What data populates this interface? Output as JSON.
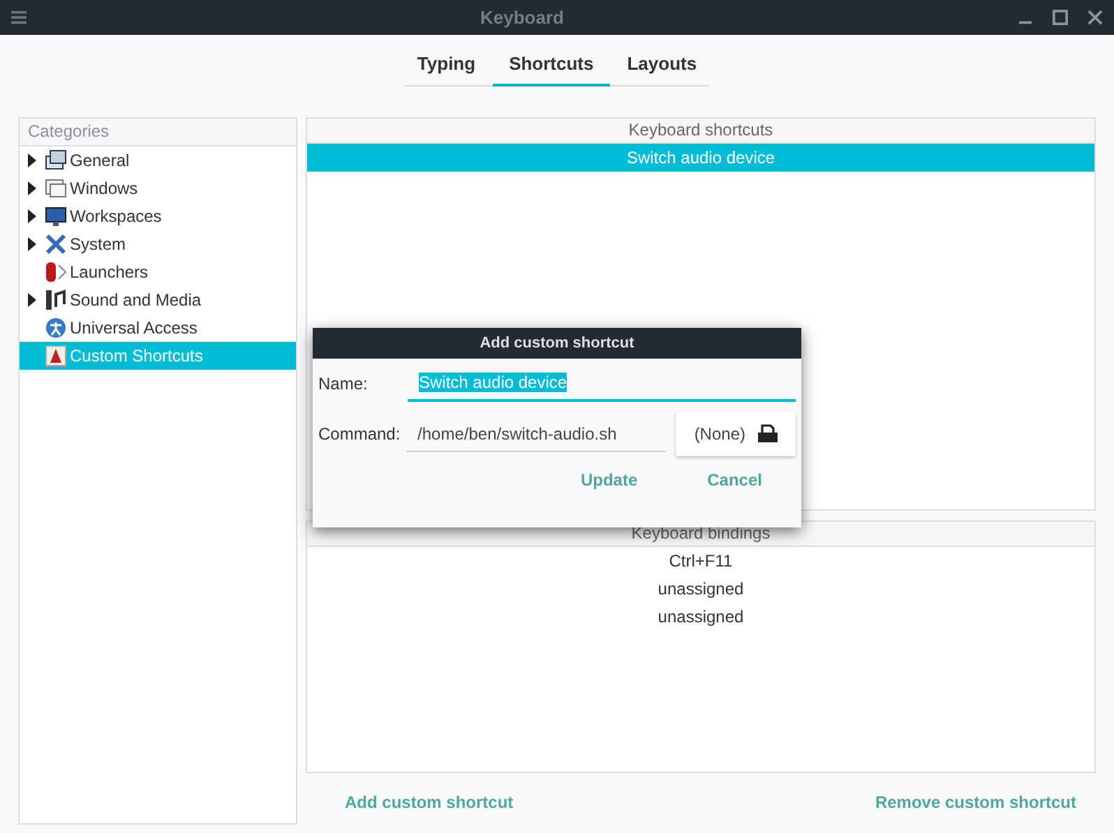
{
  "window": {
    "title": "Keyboard"
  },
  "tabs": [
    {
      "label": "Typing",
      "selected": false
    },
    {
      "label": "Shortcuts",
      "selected": true
    },
    {
      "label": "Layouts",
      "selected": false
    }
  ],
  "categories": {
    "heading": "Categories",
    "items": [
      {
        "label": "General",
        "expandable": true,
        "selected": false
      },
      {
        "label": "Windows",
        "expandable": true,
        "selected": false
      },
      {
        "label": "Workspaces",
        "expandable": true,
        "selected": false
      },
      {
        "label": "System",
        "expandable": true,
        "selected": false
      },
      {
        "label": "Launchers",
        "expandable": false,
        "selected": false
      },
      {
        "label": "Sound and Media",
        "expandable": true,
        "selected": false
      },
      {
        "label": "Universal Access",
        "expandable": false,
        "selected": false
      },
      {
        "label": "Custom Shortcuts",
        "expandable": false,
        "selected": true
      }
    ]
  },
  "shortcuts": {
    "heading": "Keyboard shortcuts",
    "rows": [
      {
        "label": "Switch audio device",
        "selected": true
      }
    ]
  },
  "bindings": {
    "heading": "Keyboard bindings",
    "rows": [
      "Ctrl+F11",
      "unassigned",
      "unassigned"
    ]
  },
  "buttons": {
    "add": "Add custom shortcut",
    "remove": "Remove custom shortcut"
  },
  "dialog": {
    "title": "Add custom shortcut",
    "name_label": "Name:",
    "name_value": "Switch audio device",
    "command_label": "Command:",
    "command_value": "/home/ben/switch-audio.sh",
    "file_button": "(None)",
    "update": "Update",
    "cancel": "Cancel"
  }
}
